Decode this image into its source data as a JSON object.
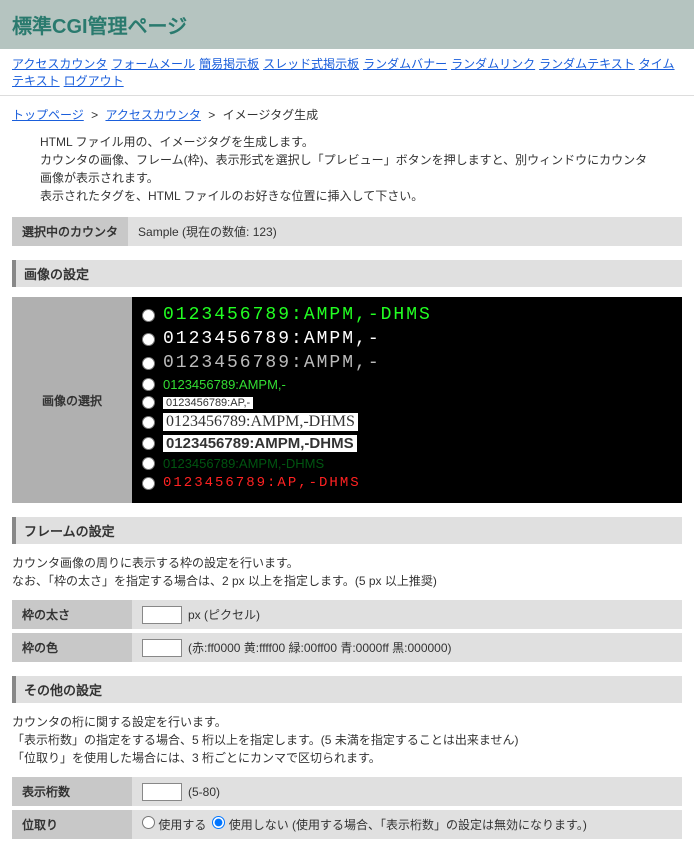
{
  "header": {
    "title": "標準CGI管理ページ"
  },
  "topnav": [
    "アクセスカウンタ",
    "フォームメール",
    "簡易掲示板",
    "スレッド式掲示板",
    "ランダムバナー",
    "ランダムリンク",
    "ランダムテキスト",
    "タイムテキスト",
    "ログアウト"
  ],
  "breadcrumb": {
    "items": [
      "トップページ",
      "アクセスカウンタ"
    ],
    "current": "イメージタグ生成",
    "sep": ">"
  },
  "description": [
    "HTML ファイル用の、イメージタグを生成します。",
    "カウンタの画像、フレーム(枠)、表示形式を選択し「プレビュー」ボタンを押しますと、別ウィンドウにカウンタ画像が表示されます。",
    "表示されたタグを、HTML ファイルのお好きな位置に挿入して下さい。"
  ],
  "selected": {
    "label": "選択中のカウンタ",
    "value": "Sample (現在の数値: 123)"
  },
  "imageSection": {
    "title": "画像の設定",
    "label": "画像の選択",
    "samples": [
      {
        "cls": "digits d-green",
        "text": "0123456789:AMPM,-DHMS"
      },
      {
        "cls": "digits d-white",
        "text": "0123456789:AMPM,-"
      },
      {
        "cls": "digits d-gray",
        "text": "0123456789:AMPM,-"
      },
      {
        "cls": "d-greens",
        "text": "0123456789:AMPM,-"
      },
      {
        "cls": "d-tiny",
        "text": "0123456789:AP,-"
      },
      {
        "cls": "d-script",
        "text": "0123456789:AMPM,-DHMS"
      },
      {
        "cls": "d-bold",
        "text": "0123456789:AMPM,-DHMS"
      },
      {
        "cls": "d-dark",
        "text": "0123456789:AMPM,-DHMS"
      },
      {
        "cls": "d-red",
        "text": "0123456789:AP,-DHMS"
      }
    ]
  },
  "frameSection": {
    "title": "フレームの設定",
    "notes": [
      "カウンタ画像の周りに表示する枠の設定を行います。",
      "なお、「枠の太さ」を指定する場合は、2 px 以上を指定します。(5 px 以上推奨)"
    ],
    "thickness": {
      "label": "枠の太さ",
      "value": "",
      "suffix": "px (ピクセル)"
    },
    "color": {
      "label": "枠の色",
      "value": "",
      "hint": "(赤:ff0000 黄:ffff00 緑:00ff00 青:0000ff 黒:000000)"
    }
  },
  "otherSection": {
    "title": "その他の設定",
    "notes": [
      "カウンタの桁に関する設定を行います。",
      "「表示桁数」の指定をする場合、5 桁以上を指定します。(5 未満を指定することは出来ません)",
      "「位取り」を使用した場合には、3 桁ごとにカンマで区切られます。"
    ],
    "digits": {
      "label": "表示桁数",
      "value": "",
      "suffix": "(5-80)"
    },
    "sep": {
      "label": "位取り",
      "opt1": "使用する",
      "opt2": "使用しない (使用する場合、「表示桁数」の設定は無効になります。)"
    }
  }
}
